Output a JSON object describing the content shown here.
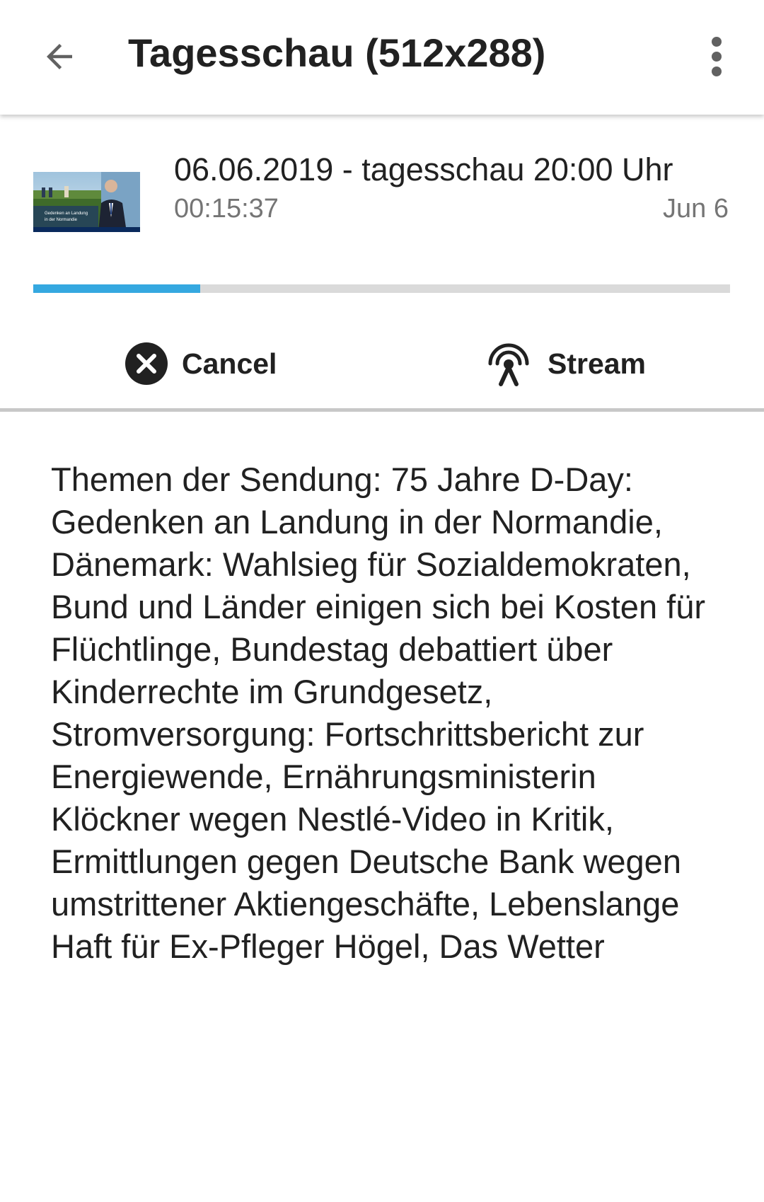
{
  "toolbar": {
    "title": "Tagesschau (512x288)",
    "back_icon": "arrow-left-icon",
    "menu_icon": "more-vertical-icon"
  },
  "episode": {
    "title": "06.06.2019 - tagesschau 20:00 Uhr",
    "duration": "00:15:37",
    "date": "Jun 6",
    "download_progress": 0.24,
    "thumbnail_caption": "Gedenken an Landung in der Normandie"
  },
  "actions": {
    "cancel_label": "Cancel",
    "cancel_icon": "cancel-circle-icon",
    "stream_label": "Stream",
    "stream_icon": "stream-antenna-icon"
  },
  "description": "Themen der Sendung: 75 Jahre D-Day: Gedenken an Landung in der Normandie, Dänemark: Wahlsieg für Sozialdemokraten, Bund und Länder einigen sich bei Kosten für Flüchtlinge, Bundestag debattiert über Kinderrechte im Grundgesetz, Stromversorgung: Fortschrittsbericht zur Energiewende, Ernährungsministerin Klöckner wegen Nestlé-Video in Kritik, Ermittlungen gegen Deutsche Bank wegen umstrittener Aktiengeschäfte, Lebenslange Haft für Ex-Pfleger Högel, Das Wetter",
  "colors": {
    "accent": "#35a8e0",
    "track": "#dadada",
    "text_primary": "#212121",
    "text_secondary": "#757575"
  }
}
